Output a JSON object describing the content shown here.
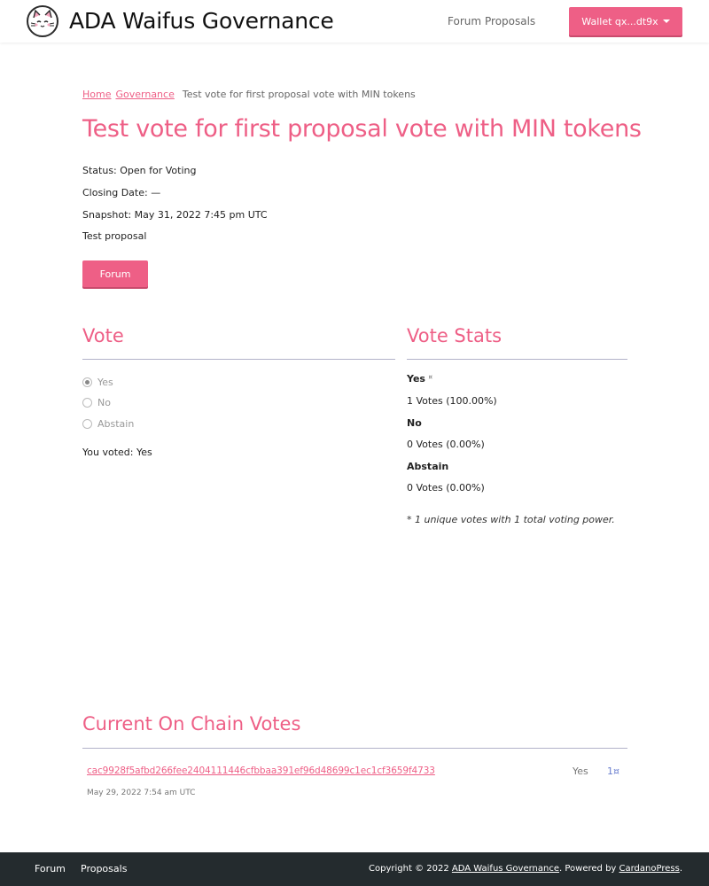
{
  "header": {
    "site_title": "ADA Waifus Governance",
    "nav": [
      {
        "label": "Forum"
      },
      {
        "label": "Proposals"
      }
    ],
    "wallet_label": "Wallet qx...dt9x"
  },
  "breadcrumb": {
    "home": "Home",
    "governance": "Governance",
    "current": "Test vote for first proposal vote with MIN tokens"
  },
  "proposal": {
    "title": "Test vote for first proposal vote with MIN tokens",
    "status": "Status: Open for Voting",
    "closing_date": "Closing Date: —",
    "snapshot": "Snapshot: May 31, 2022 7:45 pm UTC",
    "description": "Test proposal",
    "forum_button": "Forum"
  },
  "vote": {
    "heading": "Vote",
    "options": [
      {
        "label": "Yes",
        "checked": true
      },
      {
        "label": "No",
        "checked": false
      },
      {
        "label": "Abstain",
        "checked": false
      }
    ],
    "you_voted": "You voted: Yes"
  },
  "stats": {
    "heading": "Vote Stats",
    "items": [
      {
        "label": "Yes",
        "token_glyph": "¤",
        "votes": "1 Votes (100.00%)"
      },
      {
        "label": "No",
        "votes": "0 Votes (0.00%)"
      },
      {
        "label": "Abstain",
        "votes": "0 Votes (0.00%)"
      }
    ],
    "footnote": "* 1 unique votes with 1 total voting power."
  },
  "onchain": {
    "heading": "Current On Chain Votes",
    "votes": [
      {
        "tx_hash": "cac9928f5afbd266fee2404111446cfbbaa391ef96d48699c1ec1cf3659f4733",
        "date": "May 29, 2022 7:54 am UTC",
        "choice": "Yes",
        "power": "1¤"
      }
    ]
  },
  "footer": {
    "links": [
      {
        "label": "Forum"
      },
      {
        "label": "Proposals"
      }
    ],
    "copyright_prefix": "Copyright © 2022 ",
    "copyright_site": "ADA Waifus Governance",
    "powered_by": ". Powered by ",
    "powered_link": "CardanoPress",
    "end": "."
  },
  "colors": {
    "accent": "#ee5f86",
    "footer_bg": "#242b2e",
    "power_blue": "#6b7fcf"
  }
}
